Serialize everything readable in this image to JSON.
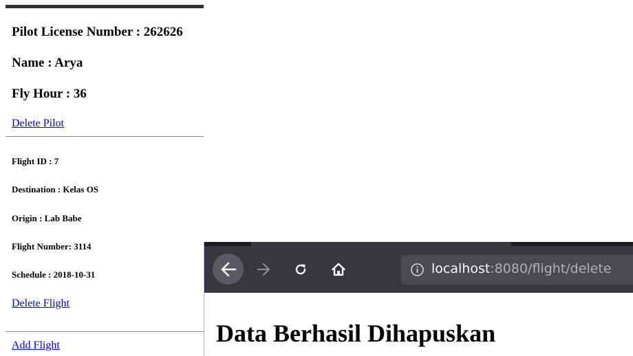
{
  "pilot": {
    "license": "Pilot License Number : 262626",
    "name": "Name : Arya",
    "fly_hour": "Fly Hour : 36",
    "delete_link": "Delete Pilot"
  },
  "flight": {
    "id": "Flight ID : 7",
    "destination": "Destination : Kelas OS",
    "origin": "Origin : Lab Babe",
    "number": "Flight Number: 3114",
    "schedule": "Schedule : 2018-10-31",
    "delete_link": "Delete Flight"
  },
  "add_flight_link": "Add Flight",
  "browser": {
    "url_host": "localhost",
    "url_rest": ":8080/flight/delete",
    "heading": "Data Berhasil Dihapuskan",
    "icons": [
      "back-arrow-icon",
      "forward-arrow-icon",
      "reload-icon",
      "home-icon",
      "info-icon"
    ],
    "colors": {
      "toolbar": "#38373e",
      "tabstrip": "#1c1b22",
      "urlbar": "#4a4a51",
      "link": "#0000ee"
    }
  }
}
